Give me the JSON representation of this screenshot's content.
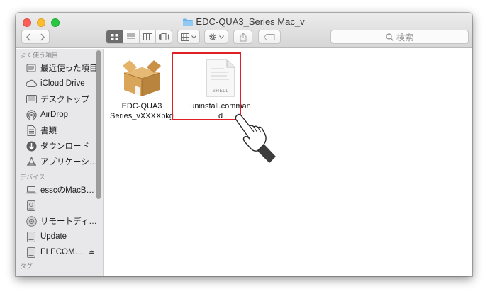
{
  "window": {
    "title": "EDC-QUA3_Series Mac_v"
  },
  "toolbar": {
    "back_icon": "chevron-left-icon",
    "forward_icon": "chevron-right-icon",
    "view_modes": [
      "icon-view",
      "list-view",
      "column-view",
      "coverflow-view"
    ],
    "arrange_icon": "arrange-grid-icon",
    "action_icon": "gear-icon",
    "share_icon": "share-icon",
    "tag_icon": "tag-icon"
  },
  "search": {
    "placeholder": "検索"
  },
  "sidebar": {
    "favorites_header": "よく使う項目",
    "favorites": [
      {
        "label": "最近使った項目",
        "icon": "recents-icon"
      },
      {
        "label": "iCloud Drive",
        "icon": "cloud-icon"
      },
      {
        "label": "デスクトップ",
        "icon": "desktop-icon"
      },
      {
        "label": "AirDrop",
        "icon": "airdrop-icon"
      },
      {
        "label": "書類",
        "icon": "documents-icon"
      },
      {
        "label": "ダウンロード",
        "icon": "download-icon"
      },
      {
        "label": "アプリケーシ…",
        "icon": "applications-icon"
      }
    ],
    "devices_header": "デバイス",
    "devices": [
      {
        "label": "esscのMacB…",
        "icon": "laptop-icon"
      },
      {
        "label": "",
        "icon": "disk-icon"
      },
      {
        "label": "リモートディ…",
        "icon": "remote-disc-icon"
      },
      {
        "label": "Update",
        "icon": "drive-icon"
      },
      {
        "label": "ELECOM…",
        "icon": "drive-icon",
        "eject": "⏏"
      }
    ],
    "tags_header": "タグ"
  },
  "files": [
    {
      "name_line1": "EDC-QUA3",
      "name_line2": "Series_vXXXXpkg",
      "icon": "package-icon"
    },
    {
      "name_line1": "uninstall.comman",
      "name_line2": "d",
      "icon": "shell-script-icon",
      "icon_label": "SHELL"
    }
  ],
  "colors": {
    "highlight": "#e01f26",
    "sidebar_bg": "#e8e8ea"
  }
}
